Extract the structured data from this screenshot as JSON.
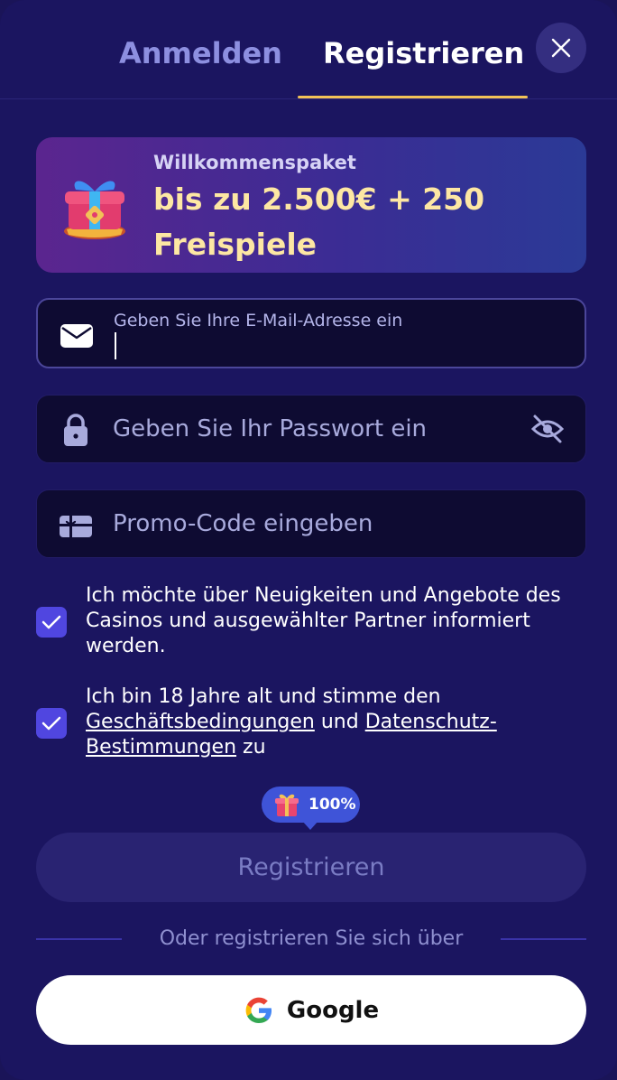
{
  "tabs": {
    "login": "Anmelden",
    "register": "Registrieren"
  },
  "icons": {
    "close": "close-icon",
    "gift": "gift-icon",
    "email": "envelope-icon",
    "password": "lock-icon",
    "visibility": "eye-off-icon",
    "promo": "gift-card-icon",
    "check": "check-icon",
    "google": "google-logo-icon"
  },
  "banner": {
    "subtitle": "Willkommenspaket",
    "title": "bis zu 2.500€ + 250 Freispiele"
  },
  "form": {
    "email_label": "Geben Sie Ihre E-Mail-Adresse ein",
    "email_value": "",
    "password_placeholder": "Geben Sie Ihr Passwort ein",
    "promo_placeholder": "Promo-Code eingeben"
  },
  "consents": {
    "newsletter": {
      "checked": true,
      "text": "Ich möchte über Neuigkeiten und Angebote des Casinos und ausgewählter Partner informiert werden."
    },
    "terms": {
      "checked": true,
      "text_before": "Ich bin 18 Jahre alt und stimme den",
      "link_terms": "Geschäftsbedingungen",
      "text_and": "und",
      "link_privacy": "Datenschutz-Bestimmungen",
      "text_after": "zu"
    }
  },
  "progress": {
    "label": "100%",
    "value": 1.0
  },
  "submit_label": "Registrieren",
  "social": {
    "divider_text": "Oder registrieren Sie sich über",
    "google_label": "Google"
  },
  "colors": {
    "background": "#1b1560",
    "accent_tab": "#f2c257",
    "checkbox": "#5046e0",
    "banner_text": "#fde7a3",
    "badge": "#3f54d8"
  }
}
